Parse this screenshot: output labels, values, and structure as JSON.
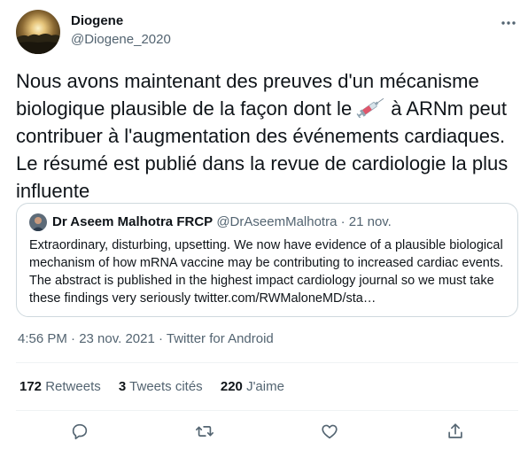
{
  "author": {
    "name": "Diogene",
    "handle": "@Diogene_2020"
  },
  "tweet": {
    "text_before_emoji": "Nous avons maintenant des preuves d'un mécanisme biologique plausible de la façon dont le",
    "emoji": "syringe-icon",
    "text_after_emoji": "à ARNm peut contribuer à l'augmentation des événements cardiaques.  Le résumé est publié dans la revue de cardiologie la plus influente"
  },
  "quoted": {
    "name": "Dr Aseem Malhotra FRCP",
    "meta": "@DrAseemMalhotra · 21 nov.",
    "text": "Extraordinary, disturbing, upsetting. We now have evidence of a plausible biological mechanism of how mRNA vaccine may be contributing to increased cardiac events. The abstract is published in the highest impact cardiology journal so we must take these findings very seriously twitter.com/RWMaloneMD/sta…"
  },
  "timestamp": "4:56 PM · 23 nov. 2021 · Twitter for Android",
  "stats": {
    "retweets_count": "172",
    "retweets_label": "Retweets",
    "quotes_count": "3",
    "quotes_label": "Tweets cités",
    "likes_count": "220",
    "likes_label": "J'aime"
  },
  "actions": [
    "reply-icon",
    "retweet-icon",
    "like-icon",
    "share-icon"
  ],
  "colors": {
    "text": "#0f1419",
    "secondary": "#536471",
    "border": "#cfd9de",
    "divider": "#eff3f4"
  }
}
